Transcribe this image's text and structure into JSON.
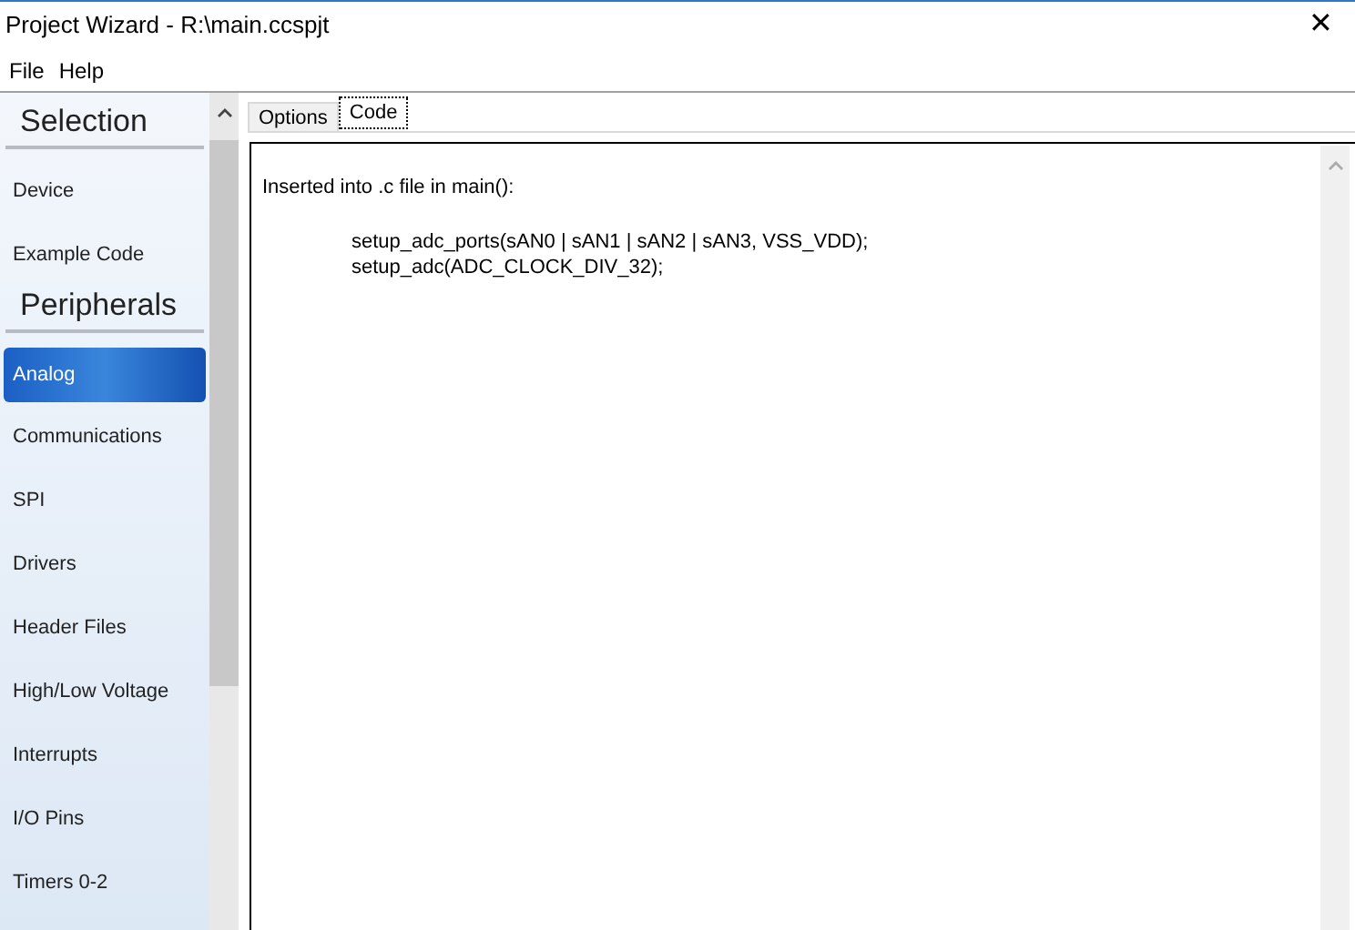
{
  "window": {
    "title": "Project Wizard - R:\\main.ccspjt",
    "close": "✕"
  },
  "menu": [
    "File",
    "Help"
  ],
  "sidebar": {
    "items": [
      {
        "kind": "heading",
        "label": "Selection"
      },
      {
        "kind": "item",
        "label": "Device",
        "selected": false
      },
      {
        "kind": "item",
        "label": "Example Code",
        "selected": false
      },
      {
        "kind": "heading",
        "label": "Peripherals"
      },
      {
        "kind": "item",
        "label": "Analog",
        "selected": true
      },
      {
        "kind": "item",
        "label": "Communications",
        "selected": false
      },
      {
        "kind": "item",
        "label": "SPI",
        "selected": false
      },
      {
        "kind": "item",
        "label": "Drivers",
        "selected": false
      },
      {
        "kind": "item",
        "label": "Header Files",
        "selected": false
      },
      {
        "kind": "item",
        "label": "High/Low Voltage",
        "selected": false
      },
      {
        "kind": "item",
        "label": "Interrupts",
        "selected": false
      },
      {
        "kind": "item",
        "label": "I/O Pins",
        "selected": false
      },
      {
        "kind": "item",
        "label": "Timers 0-2",
        "selected": false
      }
    ]
  },
  "tabs": [
    {
      "label": "Options",
      "selected": false
    },
    {
      "label": "Code",
      "selected": true
    }
  ],
  "code": {
    "intro": "Inserted into .c file in main():",
    "lines": [
      "setup_adc_ports(sAN0 | sAN1 | sAN2 | sAN3, VSS_VDD);",
      "setup_adc(ADC_CLOCK_DIV_32);"
    ]
  }
}
